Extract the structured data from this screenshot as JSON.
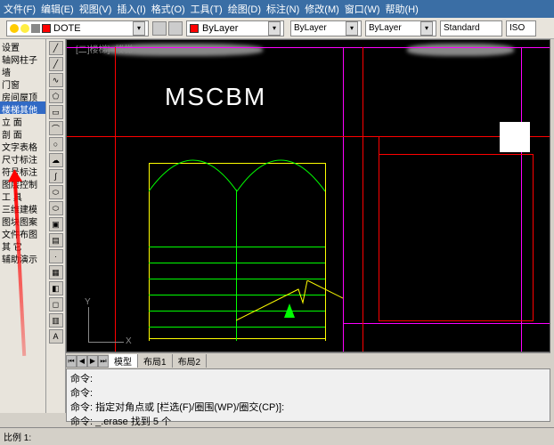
{
  "menu": {
    "items": [
      "文件(F)",
      "编辑(E)",
      "视图(V)",
      "插入(I)",
      "格式(O)",
      "工具(T)",
      "绘图(D)",
      "标注(N)",
      "修改(M)",
      "窗口(W)",
      "帮助(H)"
    ]
  },
  "toolbar": {
    "layer_name": "DOTE",
    "linetype": "ByLayer",
    "lineweight": "ByLayer",
    "plotstyle": "ByLayer",
    "style": "Standard",
    "iso": "ISO"
  },
  "left_panel": {
    "items": [
      "设置",
      "轴网柱子",
      "墙",
      "门窗",
      "房间屋顶",
      "楼梯其他",
      "立   面",
      "剖   面",
      "文字表格",
      "尺寸标注",
      "符号标注",
      "图层控制",
      "工   具",
      "三维建模",
      "图块图案",
      "文件布图",
      "其   它",
      "辅助演示"
    ],
    "highlight_index": 5
  },
  "canvas": {
    "label": "MSCBM",
    "tab_label_hint": "[二]楼梯]=楼梯"
  },
  "tabs": {
    "items": [
      "模型",
      "布局1",
      "布局2"
    ],
    "active": 0
  },
  "command": {
    "lines": [
      "命令:",
      "命令:",
      "命令: 指定对角点或 [栏选(F)/圈围(WP)/圈交(CP)]:",
      "命令: _.erase 找到 5 个"
    ],
    "prompt": "命令:"
  },
  "status": {
    "left": "比例 1:"
  },
  "ucs": {
    "x": "X",
    "y": "Y"
  },
  "chart_data": null
}
